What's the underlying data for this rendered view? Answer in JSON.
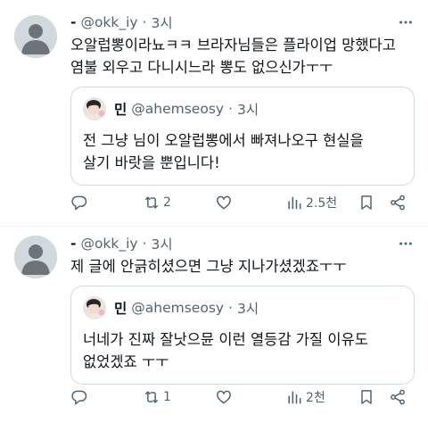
{
  "posts": [
    {
      "author": {
        "name": "-",
        "handle": "@okk_iy",
        "time": "3시"
      },
      "text": "오알럽뽕이라뇨ㅋㅋ 브라자님들은 플라이업 망했다고\n염불 외우고 다니시느라 뽕도 없으신가ㅜㅜ",
      "quote": {
        "author": {
          "name": "민",
          "handle": "@ahemseosy",
          "time": "3시"
        },
        "text": "전 그냥 님이 오알럽뽕에서 빠져나오구 현실을\n살기 바랏을 뿐입니다!"
      },
      "actions": {
        "reply_count": "",
        "repost_count": "2",
        "like_count": "",
        "view_count": "2.5천"
      }
    },
    {
      "author": {
        "name": "-",
        "handle": "@okk_iy",
        "time": "3시"
      },
      "text": "제 글에 안긁히셨으면 그냥 지나가셨겠죠ㅜㅜ",
      "quote": {
        "author": {
          "name": "민",
          "handle": "@ahemseosy",
          "time": "3시"
        },
        "text": "너네가 진짜 잘낫으뮨 이런 열등감 가질 이유도\n없었겠죠 ㅜㅜ"
      },
      "actions": {
        "reply_count": "",
        "repost_count": "1",
        "like_count": "",
        "view_count": "2천"
      }
    }
  ],
  "icons": {
    "more": "more-dots-icon",
    "reply": "reply-icon",
    "repost": "repost-icon",
    "like": "like-icon",
    "views": "views-icon",
    "bookmark": "bookmark-icon",
    "share": "share-icon"
  },
  "colors": {
    "text": "#0f1419",
    "secondary": "#536471",
    "border": "#cfd9de",
    "avatar": "#cfd9de"
  }
}
